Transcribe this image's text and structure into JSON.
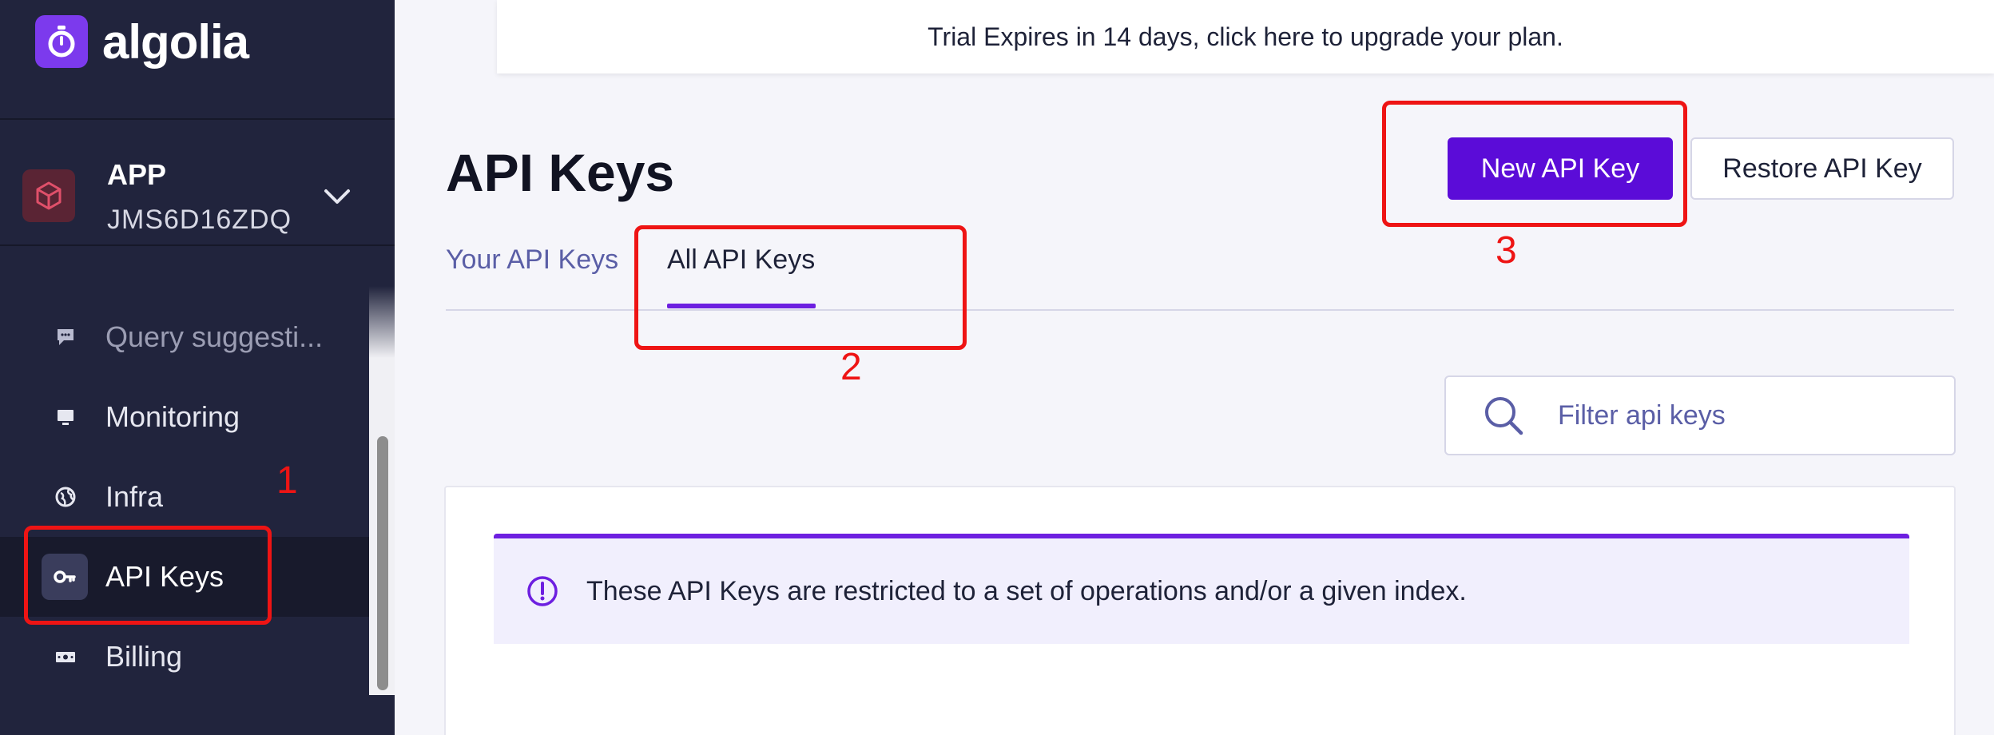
{
  "brand": {
    "name": "algolia",
    "accent": "#5b0cd8"
  },
  "app": {
    "label": "APP",
    "id": "JMS6D16ZDQ"
  },
  "sidebar": {
    "items": [
      {
        "label": "Query suggesti...",
        "icon": "speech-bubble-icon"
      },
      {
        "label": "Monitoring",
        "icon": "monitor-icon"
      },
      {
        "label": "Infra",
        "icon": "globe-icon"
      },
      {
        "label": "API Keys",
        "icon": "key-icon",
        "active": true
      },
      {
        "label": "Billing",
        "icon": "ticket-icon"
      }
    ]
  },
  "trial_banner": "Trial Expires in 14 days, click here to upgrade your plan.",
  "page": {
    "title": "API Keys",
    "primary_button": "New API Key",
    "secondary_button": "Restore API Key",
    "tabs": [
      {
        "label": "Your API Keys"
      },
      {
        "label": "All API Keys",
        "active": true
      }
    ],
    "filter": {
      "placeholder": "Filter api keys",
      "value": ""
    },
    "notice": "These API Keys are restricted to a set of operations and/or a given index."
  },
  "annotations": {
    "one": "1",
    "two": "2",
    "three": "3"
  }
}
